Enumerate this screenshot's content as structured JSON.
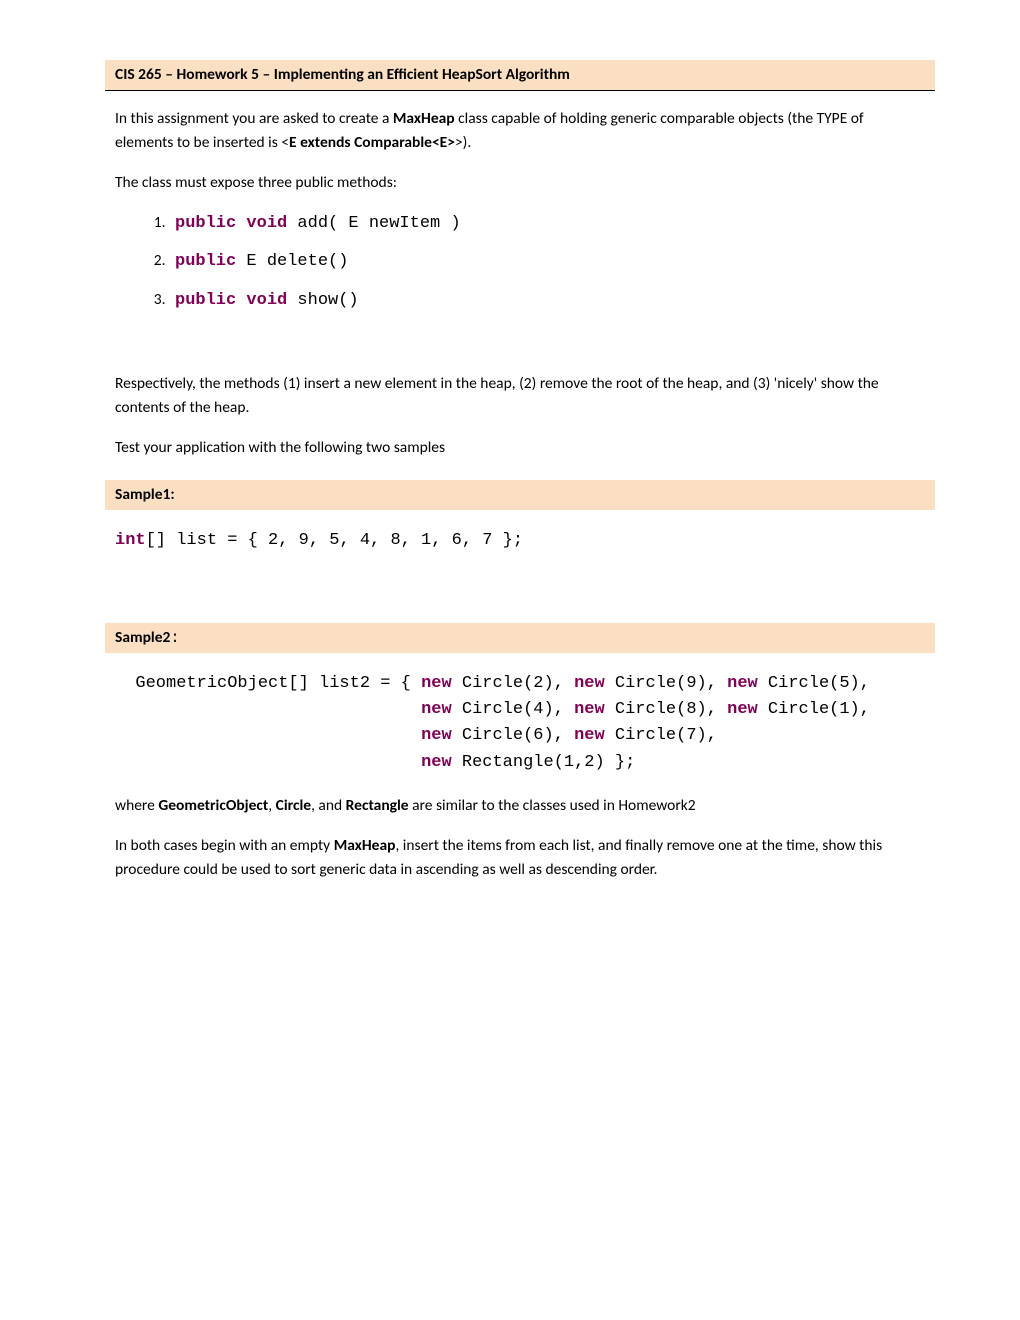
{
  "header": {
    "title": "CIS 265 – Homework 5 – Implementing an Efficient HeapSort Algorithm"
  },
  "intro": {
    "p1_pre": "In this assignment you are asked to create a ",
    "p1_bold1": "MaxHeap",
    "p1_mid": " class capable of holding generic comparable objects (the TYPE of elements to be inserted is <",
    "p1_bold2": "E extends Comparable<E>",
    "p1_post": ">).",
    "p2": "The class must expose three public methods:"
  },
  "methods": {
    "m1_kw": "public void",
    "m1_rest": "  add( E newItem )",
    "m2_kw": "public",
    "m2_rest": " E delete()",
    "m3_kw": "public void",
    "m3_rest": " show()"
  },
  "body": {
    "p3": "Respectively, the methods (1) insert a new element in the heap, (2) remove the root of the heap, and (3) 'nicely' show the contents of the heap.",
    "p4": "Test your application with the following two samples"
  },
  "sample1": {
    "label": "Sample1:",
    "code_kw": "int",
    "code_rest": "[] list = { 2, 9, 5, 4, 8, 1, 6, 7 };"
  },
  "sample2": {
    "label": "Sample2",
    "colon": ":",
    "code_line1_pre": "  GeometricObject[] list2 = { ",
    "kw_new": "new",
    "l1_a": " Circle(2), ",
    "l1_b": " Circle(9), ",
    "l1_c": " Circle(5),",
    "indent": "                              ",
    "l2_a": " Circle(4), ",
    "l2_b": " Circle(8), ",
    "l2_c": " Circle(1),",
    "l3_a": " Circle(6), ",
    "l3_b": " Circle(7),",
    "l4_a": " Rectangle(1,2) };"
  },
  "footer": {
    "p5_pre": "where ",
    "p5_b1": "GeometricObject",
    "p5_c1": ", ",
    "p5_b2": "Circle",
    "p5_c2": ", and ",
    "p5_b3": "Rectangle",
    "p5_post": " are similar to the classes used in Homework2",
    "p6_pre": "In both cases begin with an empty ",
    "p6_b1": "MaxHeap",
    "p6_post": ", insert the items from each list, and finally remove one at the time, show this procedure could be used to sort generic data in ascending as well as descending order."
  }
}
